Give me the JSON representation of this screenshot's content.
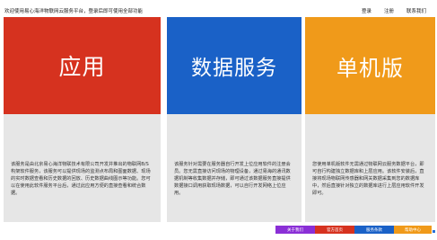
{
  "header": {
    "welcome": "欢迎使用易心海洋物联网云服务平台，登录后即可使用全部功能",
    "links": [
      "登录",
      "注册",
      "联系我们"
    ]
  },
  "panels": [
    {
      "title": "应用",
      "description": "该服务是由北京易心海洋物联技术有限公司开发并推出的物联网B/S构架软件服务，该服务可以提供现场的监测点布局和图面数据、现场的实时数据查看和历史数据的回放、历史数据曲线图示等功能。您可以在使用此软件服务平台后，通过此应用方便的直接查看和统合数据。",
      "color": "#d6321f"
    },
    {
      "title": "数据服务",
      "description": "该服务针对需要在服务器自行开发上位应用软件的注册会员。您无需直接访问现场的物理设备，通过易海的通讯数据机制等收集数据并存储，即可通过该数据服务直接提供数据接口调用获取现场数据，可以自行开发网络上位应用。",
      "color": "#1a61c7"
    },
    {
      "title": "单机版",
      "description": "您使用单机版软件无需通过物联网云服务数据平台，即可自行构建独立数据库和上层应用。该软件安装后，直接将现场物联网传感器和网关数据采集到您的数据库中，然后直接针对独立的数据库进行上层应用软件开发即可。",
      "color": "#f09a1a"
    }
  ],
  "footer": {
    "buttons": [
      "关于我们",
      "官方首页",
      "服务条款",
      "帮助中心"
    ]
  }
}
